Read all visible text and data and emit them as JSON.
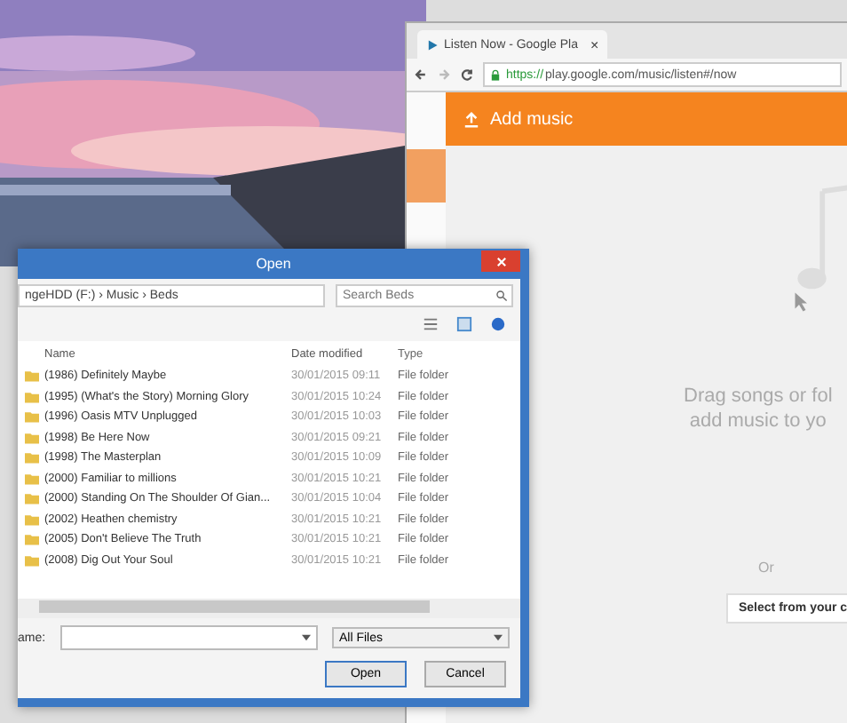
{
  "browser": {
    "tab": {
      "title": "Listen Now - Google Pla",
      "close": "×"
    },
    "address": {
      "secure": "https://",
      "url": "play.google.com/music/listen#/now"
    },
    "header": {
      "title": "Add music"
    },
    "drop_text": [
      "Drag songs or fol",
      "add music to yo"
    ],
    "or_text": "Or",
    "select_button": "Select from your c"
  },
  "dialog": {
    "title": "Open",
    "breadcrumb": "ngeHDD (F:)  ›  Music  ›  Beds",
    "search": {
      "placeholder": "Search Beds"
    },
    "columns": [
      "Name",
      "Date modified",
      "Type"
    ],
    "rows": [
      {
        "name": "(1986) Definitely Maybe",
        "date": "30/01/2015 09:11",
        "type": "File folder"
      },
      {
        "name": "(1995) (What's the Story) Morning Glory",
        "date": "30/01/2015 10:24",
        "type": "File folder"
      },
      {
        "name": "(1996) Oasis MTV Unplugged",
        "date": "30/01/2015 10:03",
        "type": "File folder"
      },
      {
        "name": "(1998) Be Here Now",
        "date": "30/01/2015 09:21",
        "type": "File folder"
      },
      {
        "name": "(1998) The Masterplan",
        "date": "30/01/2015 10:09",
        "type": "File folder"
      },
      {
        "name": "(2000) Familiar to millions",
        "date": "30/01/2015 10:21",
        "type": "File folder"
      },
      {
        "name": "(2000) Standing On The Shoulder Of Gian...",
        "date": "30/01/2015 10:04",
        "type": "File folder"
      },
      {
        "name": "(2002) Heathen chemistry",
        "date": "30/01/2015 10:21",
        "type": "File folder"
      },
      {
        "name": "(2005) Don't Believe The Truth",
        "date": "30/01/2015 10:21",
        "type": "File folder"
      },
      {
        "name": "(2008) Dig Out Your Soul",
        "date": "30/01/2015 10:21",
        "type": "File folder"
      }
    ],
    "filename_label": "ame:",
    "filetype": "All Files",
    "buttons": [
      "Open",
      "Cancel"
    ]
  }
}
